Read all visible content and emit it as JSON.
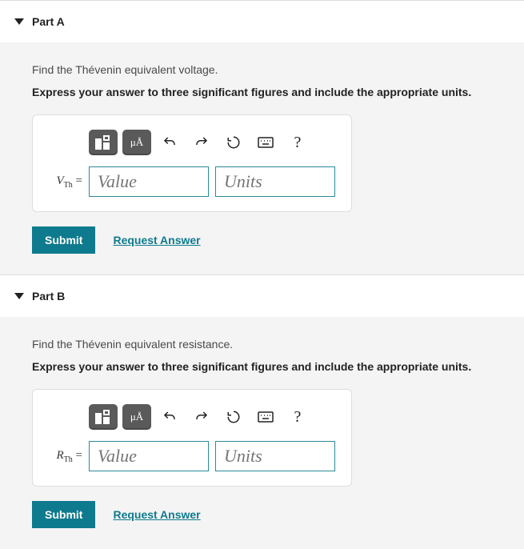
{
  "parts": [
    {
      "title": "Part A",
      "prompt": "Find the Thévenin equivalent voltage.",
      "instruction": "Express your answer to three significant figures and include the appropriate units.",
      "variable_symbol": "V",
      "variable_subscript": "Th",
      "equals": "=",
      "value_placeholder": "Value",
      "units_placeholder": "Units",
      "submit_label": "Submit",
      "request_label": "Request Answer",
      "help_label": "?"
    },
    {
      "title": "Part B",
      "prompt": "Find the Thévenin equivalent resistance.",
      "instruction": "Express your answer to three significant figures and include the appropriate units.",
      "variable_symbol": "R",
      "variable_subscript": "Th",
      "equals": "=",
      "value_placeholder": "Value",
      "units_placeholder": "Units",
      "submit_label": "Submit",
      "request_label": "Request Answer",
      "help_label": "?"
    }
  ],
  "toolbar": {
    "units_chip_label": "μÅ"
  }
}
